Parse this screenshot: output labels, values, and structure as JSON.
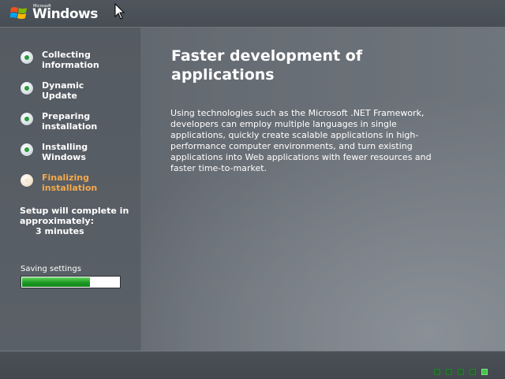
{
  "branding": {
    "company": "Microsoft",
    "product": "Windows"
  },
  "steps": [
    {
      "label": "Collecting\ninformation",
      "state": "done"
    },
    {
      "label": "Dynamic\nUpdate",
      "state": "done"
    },
    {
      "label": "Preparing\ninstallation",
      "state": "done"
    },
    {
      "label": "Installing\nWindows",
      "state": "done"
    },
    {
      "label": "Finalizing\ninstallation",
      "state": "active"
    }
  ],
  "estimate": {
    "text": "Setup will complete in approximately:",
    "time": "3 minutes"
  },
  "progress": {
    "label": "Saving settings",
    "fraction": 0.7
  },
  "content": {
    "headline": "Faster development of applications",
    "body": "Using technologies such as the Microsoft .NET Framework, developers can employ multiple languages in single applications, quickly create scalable applications in high-performance computer environments, and turn existing applications into Web applications with fewer resources and faster time-to-market."
  },
  "pager": {
    "count": 5,
    "current": 5
  },
  "colors": {
    "done": "#2c9a3c",
    "active": "#f5a94a",
    "progress": "#1d9a23"
  },
  "icons": {
    "step-done": "green-dot-icon",
    "step-active": "beige-dot-icon",
    "flag": "windows-flag-icon"
  }
}
